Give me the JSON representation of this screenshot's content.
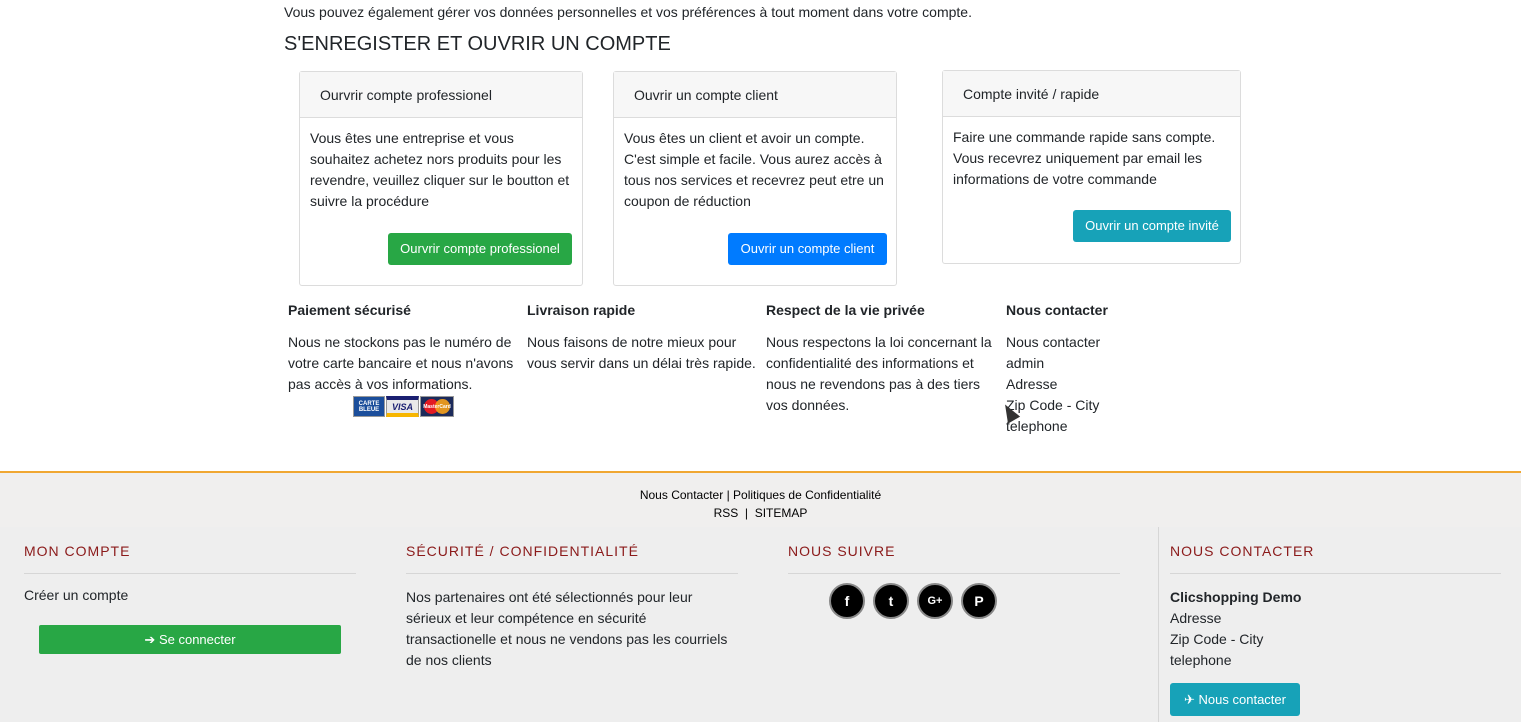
{
  "intro_text": "Vous pouvez également gérer vos données personnelles et vos préférences à tout moment dans votre compte.",
  "section_title": "S'ENREGISTER ET OUVRIR UN COMPTE",
  "cards": [
    {
      "header": "Ourvrir compte professionel",
      "body": "Vous êtes une entreprise et vous souhaitez achetez nors produits pour les revendre, veuillez cliquer sur le boutton et suivre la procédure",
      "button": "Ourvrir compte professionel",
      "button_color": "#28a745"
    },
    {
      "header": "Ouvrir un compte client",
      "body": "Vous êtes un client et avoir un compte. C'est simple et facile. Vous aurez accès à tous nos services et recevrez peut etre un coupon de réduction",
      "button": "Ouvrir un compte client",
      "button_color": "#007bff"
    },
    {
      "header": "Compte invité / rapide",
      "body": "Faire une commande rapide sans compte. Vous recevrez uniquement par email les informations de votre commande",
      "button": "Ouvrir un compte invité",
      "button_color": "#17a2b8"
    }
  ],
  "info": [
    {
      "title": "Paiement sécurisé",
      "text": "Nous ne stockons pas le numéro de votre carte bancaire et nous n'avons pas accès à vos informations."
    },
    {
      "title": "Livraison rapide",
      "text": "Nous faisons de notre mieux pour vous servir dans un délai très rapide."
    },
    {
      "title": "Respect de la vie privée",
      "text": "Nous respectons la loi concernant la confidentialité des informations et nous ne revendons pas à des tiers vos données."
    },
    {
      "title": "Nous contacter",
      "lines": [
        "Nous contacter",
        "admin",
        "Adresse",
        "Zip Code - City",
        "telephone"
      ]
    }
  ],
  "payment_logos": [
    "CARTE BLEUE",
    "VISA",
    "MasterCard"
  ],
  "footer_links": {
    "contact": "Nous Contacter",
    "separator": "|",
    "privacy": "Politiques de Confidentialité",
    "rss": "RSS",
    "sitemap": "SITEMAP"
  },
  "footer": {
    "account": {
      "title": "MON COMPTE",
      "create": "Créer un compte",
      "login": "Se connecter"
    },
    "security": {
      "title": "SÉCURITÉ / CONFIDENTIALITÉ",
      "text": "Nos partenaires ont été sélectionnés pour leur sérieux et leur compétence en sécurité transactionelle et nous ne vendons pas les courriels de nos clients"
    },
    "follow": {
      "title": "NOUS SUIVRE",
      "icons": [
        "facebook-icon",
        "twitter-icon",
        "google-plus-icon",
        "pinterest-icon"
      ]
    },
    "contact": {
      "title": "NOUS CONTACTER",
      "company": "Clicshopping Demo",
      "address": "Adresse",
      "city": "Zip Code - City",
      "phone": "telephone",
      "button": "Nous contacter"
    }
  },
  "colors": {
    "accent_orange": "#f0a732",
    "footer_heading": "#8b1a1a"
  }
}
